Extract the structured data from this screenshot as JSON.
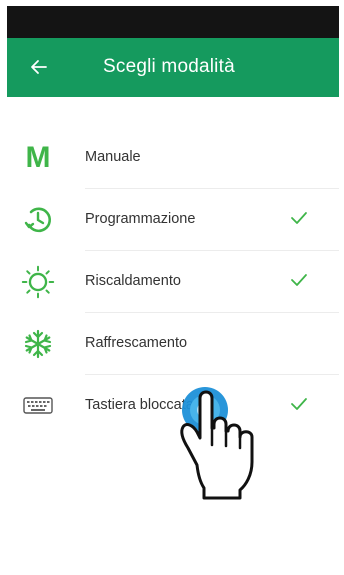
{
  "header": {
    "title": "Scegli modalità",
    "back_icon": "arrow-left-icon"
  },
  "colors": {
    "app_bar": "#159a5e",
    "status_bar": "#141414",
    "icon_green": "#3fb549",
    "tap_blue": "#1e90d8"
  },
  "modes": [
    {
      "label": "Manuale",
      "icon": "letter-m-icon",
      "checked": false
    },
    {
      "label": "Programmazione",
      "icon": "clock-icon",
      "checked": true
    },
    {
      "label": "Riscaldamento",
      "icon": "sun-icon",
      "checked": true
    },
    {
      "label": "Raffrescamento",
      "icon": "snowflake-icon",
      "checked": false
    },
    {
      "label": "Tastiera bloccata",
      "icon": "keyboard-icon",
      "checked": true
    }
  ],
  "tap_indicator": {
    "icon": "hand-pointer-icon"
  }
}
